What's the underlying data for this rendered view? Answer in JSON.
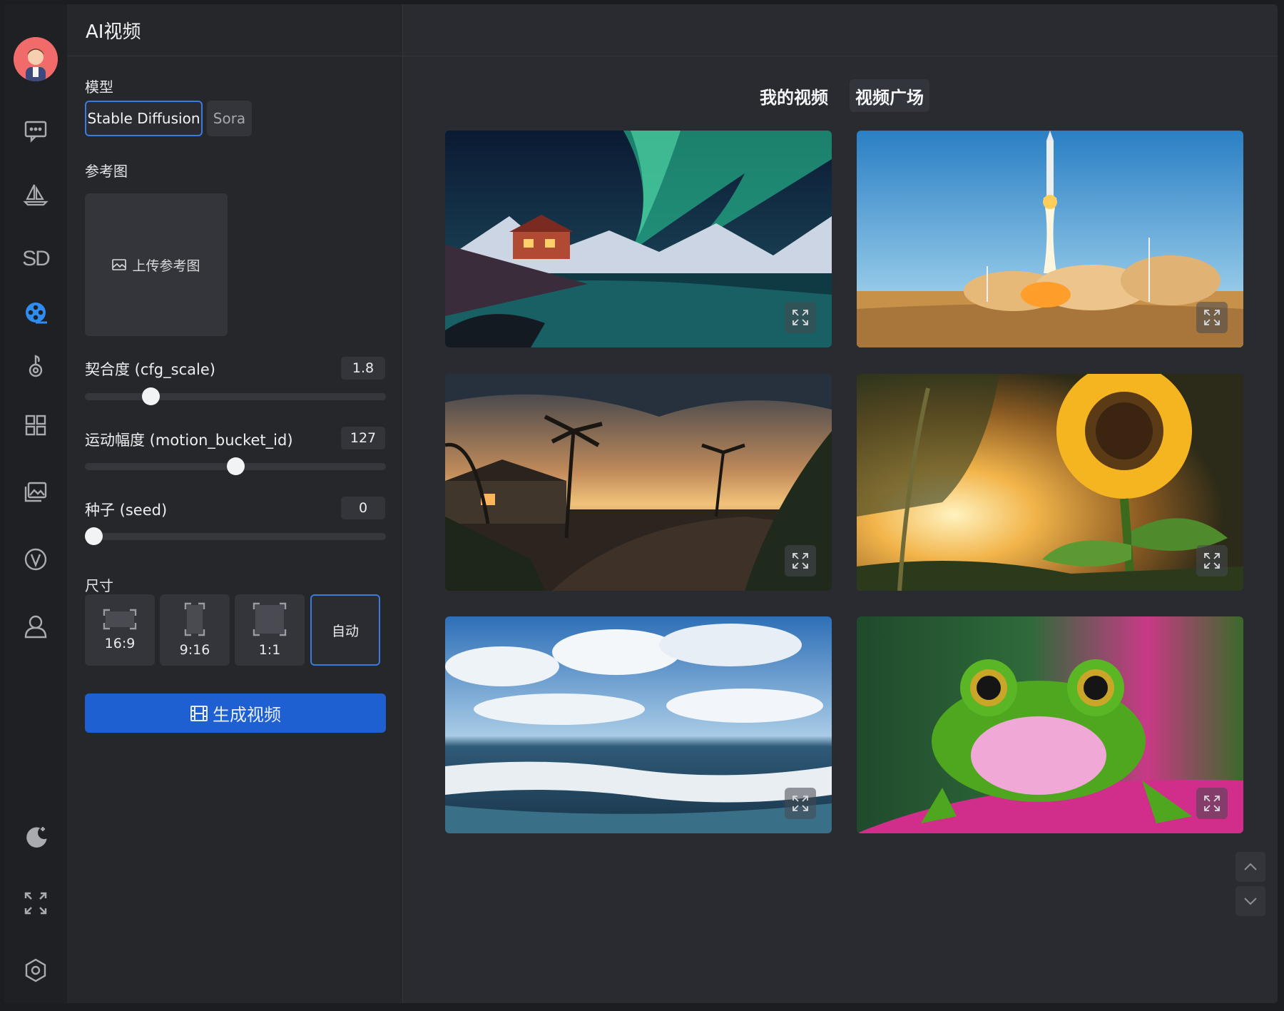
{
  "panel": {
    "title": "AI视频",
    "model_label": "模型",
    "models": [
      "Stable Diffusion",
      "Sora"
    ],
    "selected_model": "Stable Diffusion",
    "ref_label": "参考图",
    "upload_label": "上传参考图",
    "sliders": [
      {
        "label": "契合度 (cfg_scale)",
        "value": "1.8",
        "fraction": 0.2
      },
      {
        "label": "运动幅度 (motion_bucket_id)",
        "value": "127",
        "fraction": 0.5
      },
      {
        "label": "种子 (seed)",
        "value": "0",
        "fraction": 0.0
      }
    ],
    "size_label": "尺寸",
    "sizes": [
      "16:9",
      "9:16",
      "1:1",
      "自动"
    ],
    "selected_size": "自动",
    "generate_label": "生成视频"
  },
  "main": {
    "tabs": [
      "我的视频",
      "视频广场"
    ],
    "active_tab": "视频广场",
    "videos": [
      {
        "subject": "aurora-over-cabin"
      },
      {
        "subject": "rocket-launch"
      },
      {
        "subject": "tropical-sunset-driveway"
      },
      {
        "subject": "sunflower-at-sunset"
      },
      {
        "subject": "ocean-clouds"
      },
      {
        "subject": "green-frog"
      }
    ]
  },
  "rail": {
    "icons": [
      "avatar",
      "chat-icon",
      "sailboat-icon",
      "sd-icon",
      "video-reel-icon",
      "music-note-icon",
      "apps-grid-icon",
      "image-gallery-icon",
      "v-badge-icon",
      "user-icon",
      "moon-icon",
      "fullscreen-icon",
      "settings-hex-icon"
    ],
    "sd_text": "SD",
    "active": "video-reel-icon"
  },
  "colors": {
    "accent": "#1e5fd1",
    "active_icon": "#2f8cf0",
    "border_active": "#3a7bdf"
  }
}
